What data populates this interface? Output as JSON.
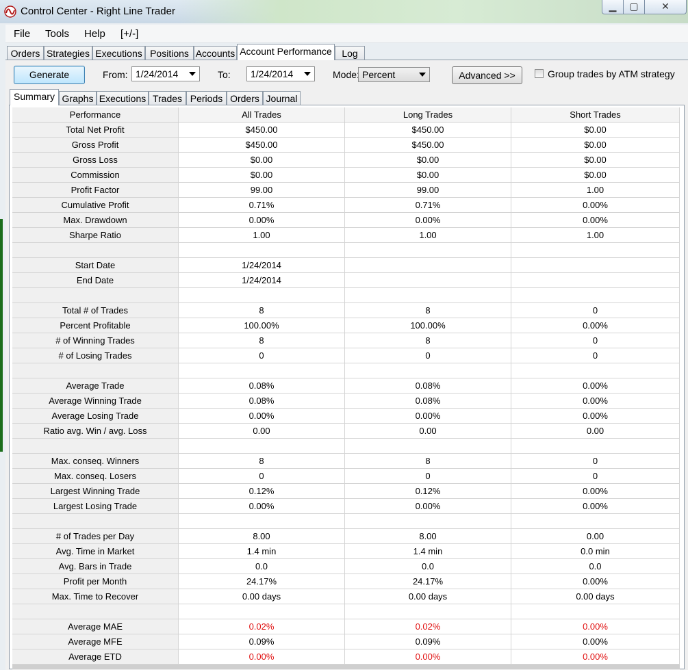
{
  "window": {
    "title": "Control Center - Right Line Trader"
  },
  "menu": [
    "File",
    "Tools",
    "Help",
    "[+/-]"
  ],
  "main_tabs": [
    "Orders",
    "Strategies",
    "Executions",
    "Positions",
    "Accounts",
    "Account Performance",
    "Log"
  ],
  "toolbar": {
    "generate_label": "Generate",
    "from_label": "From:",
    "from_value": "1/24/2014",
    "to_label": "To:",
    "to_value": "1/24/2014",
    "mode_label": "Mode:",
    "mode_value": "Percent",
    "advanced_label": "Advanced >>",
    "group_trades_label": "Group trades by ATM strategy",
    "group_trades_checked": false
  },
  "sub_tabs": [
    "Summary",
    "Graphs",
    "Executions",
    "Trades",
    "Periods",
    "Orders",
    "Journal"
  ],
  "table": {
    "headers": [
      "Performance",
      "All Trades",
      "Long Trades",
      "Short Trades"
    ],
    "rows": [
      [
        "Total Net Profit",
        "$450.00",
        "$450.00",
        "$0.00"
      ],
      [
        "Gross Profit",
        "$450.00",
        "$450.00",
        "$0.00"
      ],
      [
        "Gross Loss",
        "$0.00",
        "$0.00",
        "$0.00"
      ],
      [
        "Commission",
        "$0.00",
        "$0.00",
        "$0.00"
      ],
      [
        "Profit Factor",
        "99.00",
        "99.00",
        "1.00"
      ],
      [
        "Cumulative Profit",
        "0.71%",
        "0.71%",
        "0.00%"
      ],
      [
        "Max. Drawdown",
        "0.00%",
        "0.00%",
        "0.00%"
      ],
      [
        "Sharpe Ratio",
        "1.00",
        "1.00",
        "1.00"
      ],
      [
        "",
        "",
        "",
        ""
      ],
      [
        "Start Date",
        "1/24/2014",
        "",
        ""
      ],
      [
        "End Date",
        "1/24/2014",
        "",
        ""
      ],
      [
        "",
        "",
        "",
        ""
      ],
      [
        "Total # of Trades",
        "8",
        "8",
        "0"
      ],
      [
        "Percent Profitable",
        "100.00%",
        "100.00%",
        "0.00%"
      ],
      [
        "# of Winning Trades",
        "8",
        "8",
        "0"
      ],
      [
        "# of Losing Trades",
        "0",
        "0",
        "0"
      ],
      [
        "",
        "",
        "",
        ""
      ],
      [
        "Average Trade",
        "0.08%",
        "0.08%",
        "0.00%"
      ],
      [
        "Average Winning Trade",
        "0.08%",
        "0.08%",
        "0.00%"
      ],
      [
        "Average Losing Trade",
        "0.00%",
        "0.00%",
        "0.00%"
      ],
      [
        "Ratio avg. Win / avg. Loss",
        "0.00",
        "0.00",
        "0.00"
      ],
      [
        "",
        "",
        "",
        ""
      ],
      [
        "Max. conseq. Winners",
        "8",
        "8",
        "0"
      ],
      [
        "Max. conseq. Losers",
        "0",
        "0",
        "0"
      ],
      [
        "Largest Winning Trade",
        "0.12%",
        "0.12%",
        "0.00%"
      ],
      [
        "Largest Losing Trade",
        "0.00%",
        "0.00%",
        "0.00%"
      ],
      [
        "",
        "",
        "",
        ""
      ],
      [
        "# of Trades per Day",
        "8.00",
        "8.00",
        "0.00"
      ],
      [
        "Avg. Time in Market",
        "1.4 min",
        "1.4 min",
        "0.0 min"
      ],
      [
        "Avg. Bars in Trade",
        "0.0",
        "0.0",
        "0.0"
      ],
      [
        "Profit per Month",
        "24.17%",
        "24.17%",
        "0.00%"
      ],
      [
        "Max. Time to Recover",
        "0.00 days",
        "0.00 days",
        "0.00 days"
      ],
      [
        "",
        "",
        "",
        ""
      ],
      [
        "Average MAE",
        "0.02%",
        "0.02%",
        "0.00%"
      ],
      [
        "Average MFE",
        "0.09%",
        "0.09%",
        "0.00%"
      ],
      [
        "Average ETD",
        "0.00%",
        "0.00%",
        "0.00%"
      ]
    ],
    "red_value_rows": [
      "Average MAE",
      "Average ETD"
    ],
    "red_color": "#e01010"
  }
}
